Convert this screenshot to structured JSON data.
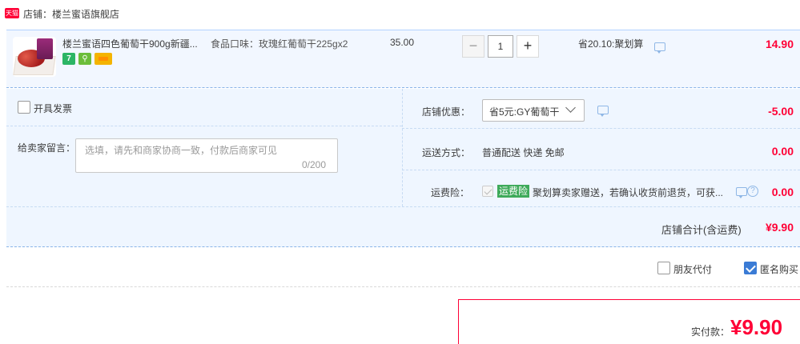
{
  "shop": {
    "badge": "天猫",
    "label": "店铺：楼兰蜜语旗舰店"
  },
  "item": {
    "title": "楼兰蜜语四色葡萄干900g新疆...",
    "sku": "食品口味：玫瑰红葡萄干225gx2",
    "unit_price": "35.00",
    "quantity": "1",
    "minus": "−",
    "plus": "+",
    "discount": "省20.10:聚划算",
    "subtotal": "14.90",
    "icons": [
      "seven-day-return-icon",
      "green-service-icon",
      "gold-card-icon"
    ],
    "icon_seven": "7"
  },
  "options": {
    "invoice_label": "开具发票",
    "invoice_checked": false,
    "message_label": "给卖家留言：",
    "message_placeholder": "选填，请先和商家协商一致，付款后商家可见",
    "message_count": "0/200",
    "shop_discount_label": "店铺优惠：",
    "shop_discount_value": "省5元:GY葡萄干",
    "shop_discount_amount": "-5.00",
    "shipping_label": "运送方式：",
    "shipping_value": "普通配送 快递 免邮",
    "shipping_amount": "0.00",
    "insurance_label": "运费险：",
    "insurance_badge": "运费险",
    "insurance_text": "聚划算卖家赠送，若确认收货前退货，可获...",
    "insurance_amount": "0.00",
    "insurance_checked": true
  },
  "total": {
    "label": "店铺合计(含运费)",
    "amount": "¥9.90"
  },
  "bottom": {
    "friend_pay_label": "朋友代付",
    "friend_pay_checked": false,
    "anonymous_label": "匿名购买",
    "anonymous_checked": true,
    "pay_label": "实付款：",
    "pay_amount": "¥9.90"
  },
  "colors": {
    "accent_red": "#ff0036",
    "row_bg": "#f2f7ff",
    "checkbox_blue": "#3a7bd5",
    "insurance_green": "#3eaa5a"
  }
}
